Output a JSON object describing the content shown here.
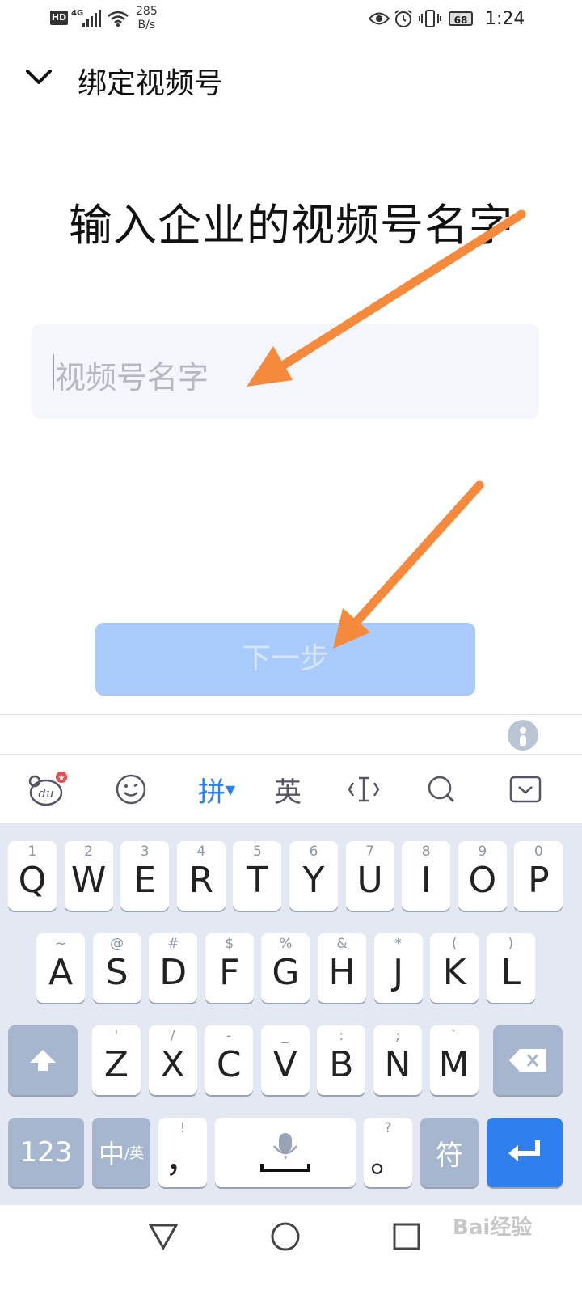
{
  "status_bar": {
    "hd_badge": "HD",
    "network": "4G",
    "speed_value": "285",
    "speed_unit": "B/s",
    "battery": "68",
    "time": "1:24"
  },
  "header": {
    "title": "绑定视频号"
  },
  "main": {
    "heading": "输入企业的视频号名字",
    "input_placeholder": "视频号名字",
    "input_value": "",
    "next_button": "下一步"
  },
  "ime_toolbar": {
    "logo_text": "du",
    "pinyin_label": "拼",
    "english_label": "英"
  },
  "keyboard": {
    "row1": [
      {
        "k": "Q",
        "h": "1"
      },
      {
        "k": "W",
        "h": "2"
      },
      {
        "k": "E",
        "h": "3"
      },
      {
        "k": "R",
        "h": "4"
      },
      {
        "k": "T",
        "h": "5"
      },
      {
        "k": "Y",
        "h": "6"
      },
      {
        "k": "U",
        "h": "7"
      },
      {
        "k": "I",
        "h": "8"
      },
      {
        "k": "O",
        "h": "9"
      },
      {
        "k": "P",
        "h": "0"
      }
    ],
    "row2": [
      {
        "k": "A",
        "h": "~"
      },
      {
        "k": "S",
        "h": "@"
      },
      {
        "k": "D",
        "h": "#"
      },
      {
        "k": "F",
        "h": "$"
      },
      {
        "k": "G",
        "h": "%"
      },
      {
        "k": "H",
        "h": "&"
      },
      {
        "k": "J",
        "h": "*"
      },
      {
        "k": "K",
        "h": "("
      },
      {
        "k": "L",
        "h": ")"
      }
    ],
    "row3": [
      {
        "k": "Z",
        "h": "'"
      },
      {
        "k": "X",
        "h": "/"
      },
      {
        "k": "C",
        "h": "-"
      },
      {
        "k": "V",
        "h": "_"
      },
      {
        "k": "B",
        "h": ":"
      },
      {
        "k": "N",
        "h": ";"
      },
      {
        "k": "M",
        "h": "`"
      }
    ],
    "num_key": "123",
    "lang_key_main": "中",
    "lang_key_sub": "/英",
    "comma_key": "，",
    "comma_hint": "!",
    "period_key": "。",
    "period_hint": "?",
    "symbol_key": "符"
  },
  "watermark": "Bai经验"
}
